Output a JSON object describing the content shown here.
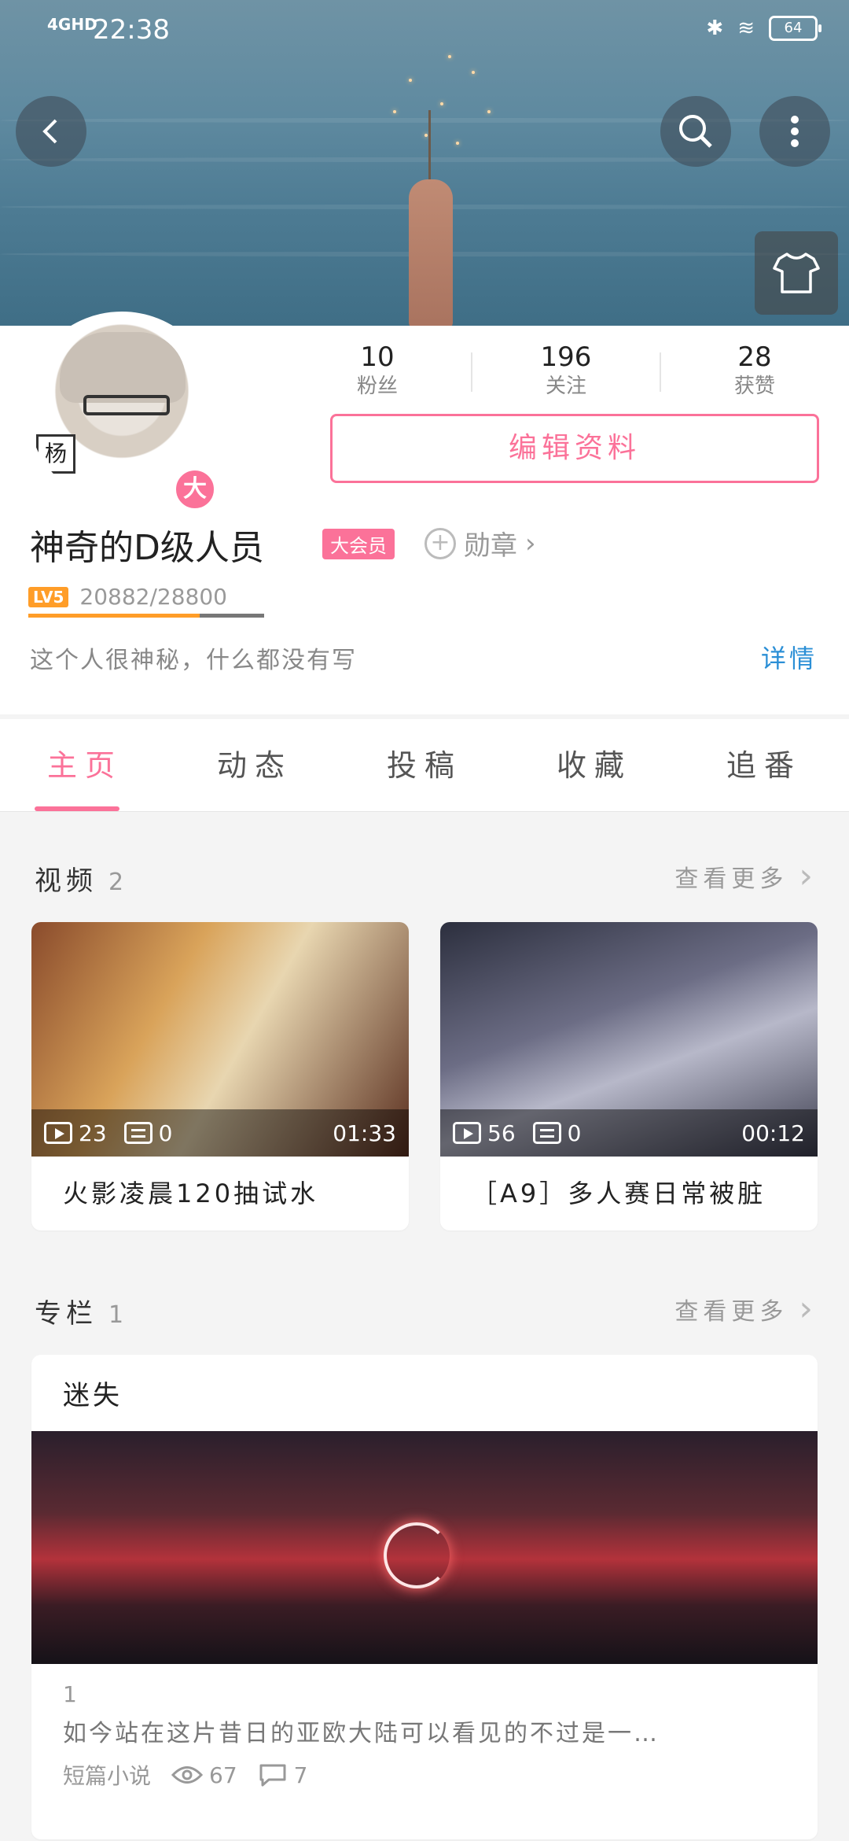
{
  "status_bar": {
    "network": "4GHD",
    "time": "22:38",
    "battery": "64"
  },
  "header": {
    "back_icon": "back-arrow-icon",
    "search_icon": "search-icon",
    "more_icon": "more-vertical-icon",
    "theme_icon": "shirt-icon"
  },
  "profile": {
    "avatar_seal": "杨",
    "vip_badge": "大",
    "stats": [
      {
        "num": "10",
        "label": "粉丝"
      },
      {
        "num": "196",
        "label": "关注"
      },
      {
        "num": "28",
        "label": "获赞"
      }
    ],
    "edit_label": "编辑资料",
    "name": "神奇的D级人员",
    "vip_tag": "大会员",
    "medal_label": "勋章",
    "level": "LV5",
    "exp": "20882/28800",
    "exp_progress": 0.725,
    "bio": "这个人很神秘，什么都没有写",
    "details": "详情"
  },
  "tabs": [
    "主页",
    "动态",
    "投稿",
    "收藏",
    "追番"
  ],
  "videos": {
    "title": "视频",
    "count": "2",
    "more": "查看更多",
    "items": [
      {
        "plays": "23",
        "danmaku": "0",
        "duration": "01:33",
        "title": "火影凌晨120抽试水"
      },
      {
        "plays": "56",
        "danmaku": "0",
        "duration": "00:12",
        "title": "［A9］多人赛日常被脏"
      }
    ]
  },
  "column": {
    "title": "专栏",
    "count": "1",
    "more": "查看更多",
    "article": {
      "title": "迷失",
      "number": "1",
      "snippet": "如今站在这片昔日的亚欧大陆可以看见的不过是一…",
      "category": "短篇小说",
      "views": "67",
      "comments": "7"
    }
  },
  "colors": {
    "accent": "#fb7299",
    "link": "#2b8fd6",
    "level": "#ff9d28"
  }
}
